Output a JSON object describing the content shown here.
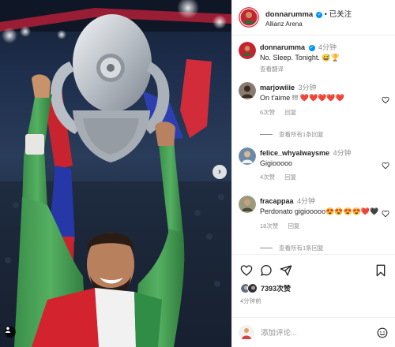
{
  "post": {
    "author": "donnarumma",
    "follow_status": "已关注",
    "location": "Allianz Arena",
    "caption_time": "4分钟",
    "caption_text": "No. Sleep. Tonight. 😅🏆",
    "see_translation": "查看翻译"
  },
  "comments": [
    {
      "user": "marjowiiie",
      "time": "3分钟",
      "text": "On t'aime !!! ❤️❤️❤️❤️❤️",
      "likes": "6次赞",
      "reply": "回复",
      "replies_label": "查看所有1条回复"
    },
    {
      "user": "felice_whyalwaysme",
      "time": "4分钟",
      "text": "Gigiooooo",
      "likes": "4次赞",
      "reply": "回复",
      "replies_label": ""
    },
    {
      "user": "fracappaa",
      "time": "4分钟",
      "text": "Perdonato gigiooooo😍😍😍😍❤️🖤",
      "likes": "18次赞",
      "reply": "回复",
      "replies_label": "查看所有1条回复"
    }
  ],
  "actions": {
    "likes": "7393次赞",
    "time_ago": "4分钟前"
  },
  "comment_box": {
    "placeholder": "添加评论..."
  },
  "icons": [
    "heart-icon",
    "comment-icon",
    "share-icon",
    "bookmark-icon",
    "emoji-icon",
    "chevron-right-icon",
    "tag-user-icon",
    "verified-badge-icon"
  ],
  "colors": {
    "accent": "#0095f6",
    "text": "#262626",
    "muted": "#8e8e8e",
    "jersey": "#3f9a4c",
    "trophy": "#c9ced4"
  }
}
